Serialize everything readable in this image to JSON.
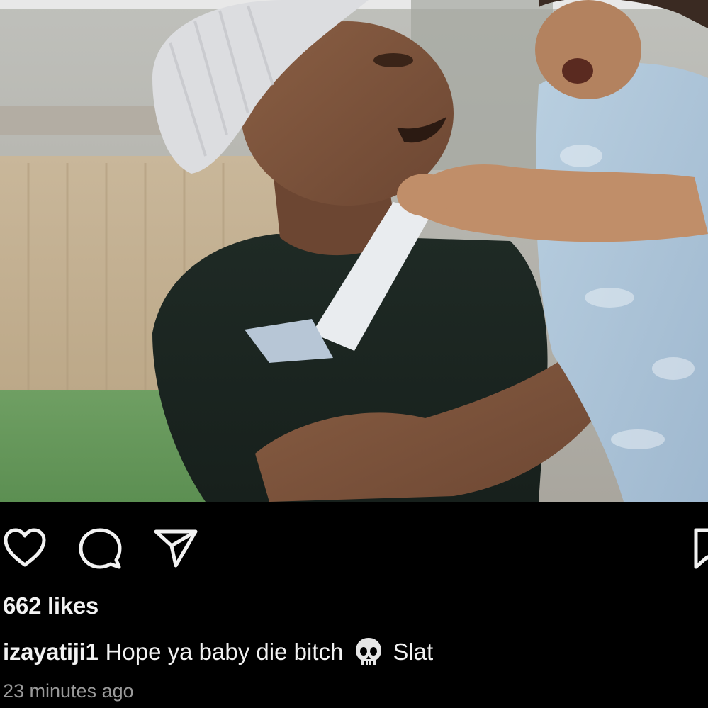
{
  "post": {
    "image_alt": "Man in a white knit beanie and black t-shirt holding a crying toddler in a light blue shirt outdoors in a backyard",
    "actions": {
      "like_icon": "heart-outline-icon",
      "comment_icon": "speech-bubble-icon",
      "share_icon": "paper-plane-icon",
      "save_icon": "bookmark-icon"
    },
    "likes_label": "662 likes",
    "caption": {
      "username": "izayatiji1",
      "text": "Hope ya baby die bitch",
      "emoji_icon": "skull-emoji-icon",
      "suffix": "Slat"
    },
    "timestamp": "23 minutes ago"
  },
  "colors": {
    "background": "#000000",
    "text": "#f2f2f2",
    "muted": "#9a9a9a"
  }
}
